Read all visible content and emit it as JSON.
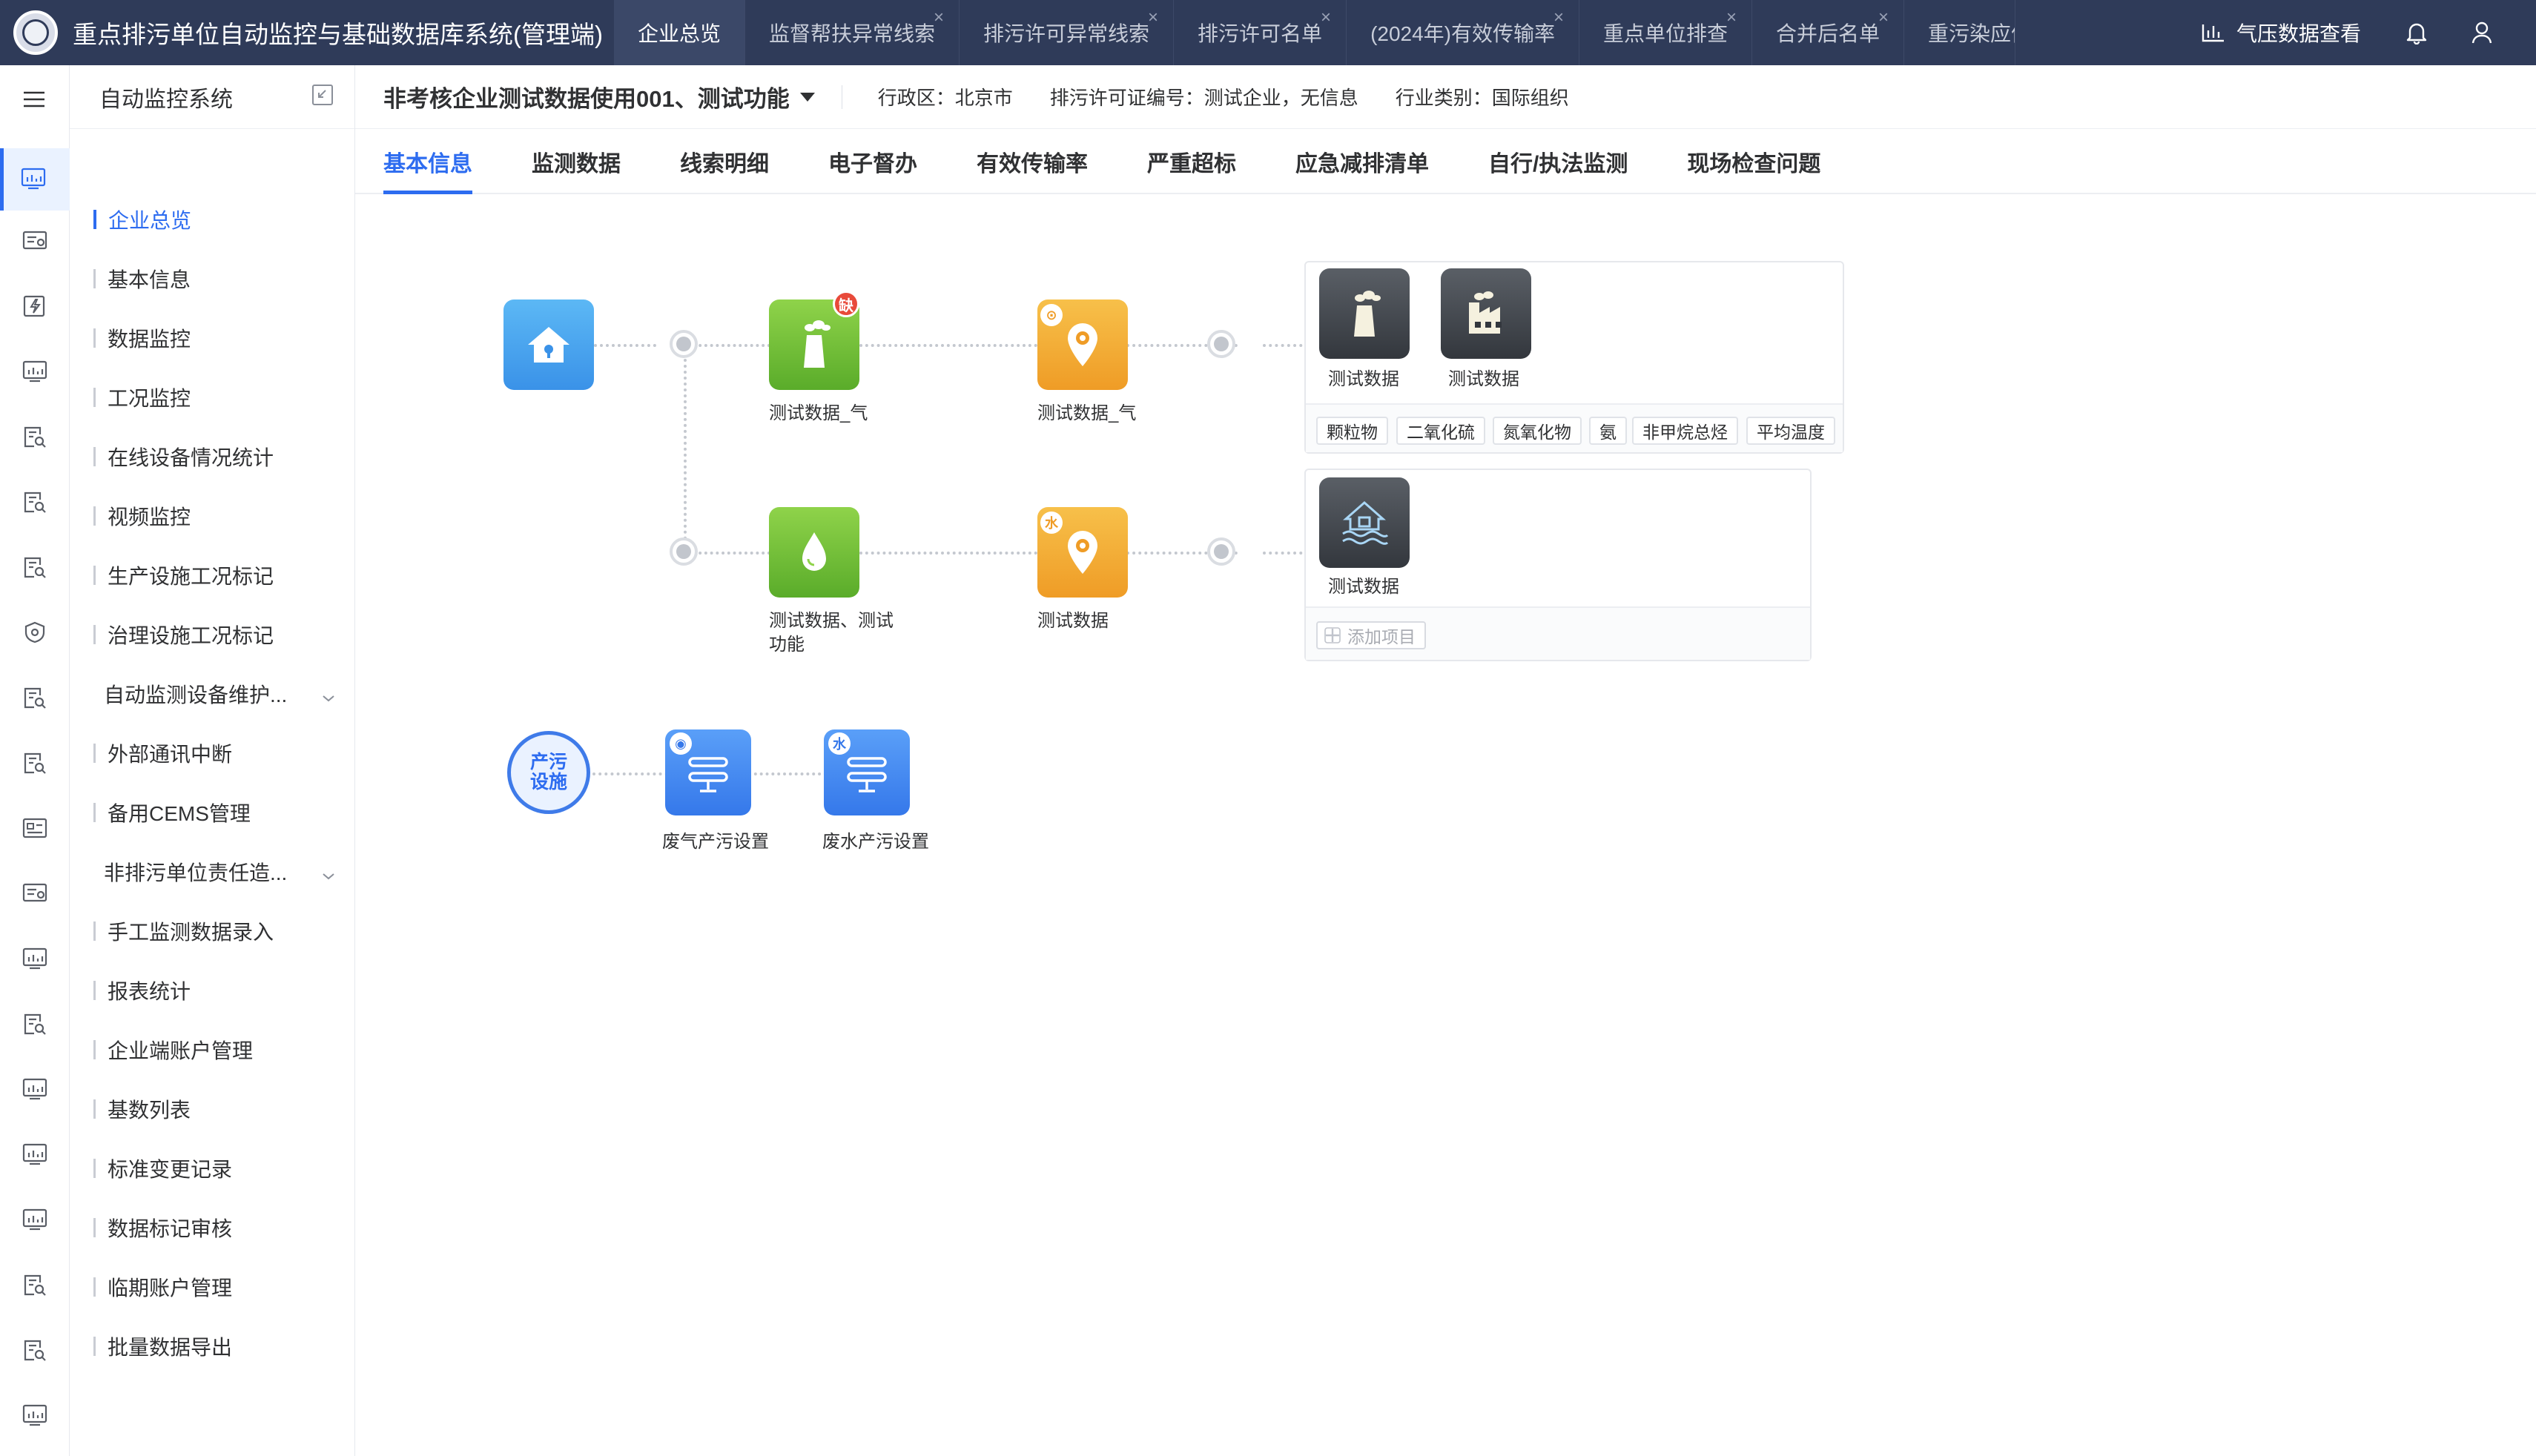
{
  "app": {
    "title": "重点排污单位自动监控与基础数据库系统(管理端)"
  },
  "top_tabs": [
    {
      "label": "企业总览",
      "active": true,
      "closable": false
    },
    {
      "label": "监督帮扶异常线索",
      "active": false,
      "closable": true
    },
    {
      "label": "排污许可异常线索",
      "active": false,
      "closable": true
    },
    {
      "label": "排污许可名单",
      "active": false,
      "closable": true
    },
    {
      "label": "(2024年)有效传输率",
      "active": false,
      "closable": true
    },
    {
      "label": "重点单位排查",
      "active": false,
      "closable": true
    },
    {
      "label": "合并后名单",
      "active": false,
      "closable": true
    },
    {
      "label": "重污染应停",
      "active": false,
      "closable": false
    }
  ],
  "top_right": {
    "pressure_label": "气压数据查看"
  },
  "sidebar": {
    "title": "自动监控系统",
    "items": [
      {
        "label": "企业总览",
        "active": true,
        "group": false
      },
      {
        "label": "基本信息",
        "active": false,
        "group": false
      },
      {
        "label": "数据监控",
        "active": false,
        "group": false
      },
      {
        "label": "工况监控",
        "active": false,
        "group": false
      },
      {
        "label": "在线设备情况统计",
        "active": false,
        "group": false
      },
      {
        "label": "视频监控",
        "active": false,
        "group": false
      },
      {
        "label": "生产设施工况标记",
        "active": false,
        "group": false
      },
      {
        "label": "治理设施工况标记",
        "active": false,
        "group": false
      },
      {
        "label": "自动监测设备维护...",
        "active": false,
        "group": true
      },
      {
        "label": "外部通讯中断",
        "active": false,
        "group": false
      },
      {
        "label": "备用CEMS管理",
        "active": false,
        "group": false
      },
      {
        "label": "非排污单位责任造...",
        "active": false,
        "group": true
      },
      {
        "label": "手工监测数据录入",
        "active": false,
        "group": false
      },
      {
        "label": "报表统计",
        "active": false,
        "group": false
      },
      {
        "label": "企业端账户管理",
        "active": false,
        "group": false
      },
      {
        "label": "基数列表",
        "active": false,
        "group": false
      },
      {
        "label": "标准变更记录",
        "active": false,
        "group": false
      },
      {
        "label": "数据标记审核",
        "active": false,
        "group": false
      },
      {
        "label": "临期账户管理",
        "active": false,
        "group": false
      },
      {
        "label": "批量数据导出",
        "active": false,
        "group": false
      }
    ]
  },
  "enterprise": {
    "name": "非考核企业测试数据使用001、测试功能",
    "region": "行政区：北京市",
    "permit": "排污许可证编号：测试企业，无信息",
    "industry": "行业类别：国际组织"
  },
  "sub_tabs": [
    {
      "label": "基本信息",
      "active": true
    },
    {
      "label": "监测数据",
      "active": false
    },
    {
      "label": "线索明细",
      "active": false
    },
    {
      "label": "电子督办",
      "active": false
    },
    {
      "label": "有效传输率",
      "active": false
    },
    {
      "label": "严重超标",
      "active": false
    },
    {
      "label": "应急减排清单",
      "active": false
    },
    {
      "label": "自行/执法监测",
      "active": false
    },
    {
      "label": "现场检查问题",
      "active": false
    }
  ],
  "diagram": {
    "gas_outlet": {
      "label": "测试数据_气",
      "badge": "缺"
    },
    "gas_point": {
      "label": "测试数据_气"
    },
    "water_outlet": {
      "label_line1": "测试数据、测试",
      "label_line2": "功能"
    },
    "water_point": {
      "label": "测试数据"
    },
    "gas_panel": {
      "items": [
        "测试数据",
        "测试数据"
      ],
      "pollutants": [
        "颗粒物",
        "二氧化硫",
        "氮氧化物",
        "氨",
        "非甲烷总烃",
        "平均温度"
      ]
    },
    "water_panel": {
      "items": [
        "测试数据"
      ],
      "add_label": "添加项目"
    },
    "production": {
      "circle_label": "产污设施",
      "gas_setting": "废气产污设置",
      "water_setting": "废水产污设置",
      "water_badge": "水"
    }
  },
  "colors": {
    "accent": "#2d6cf0",
    "topbar": "#2f3b59",
    "badge": "#e84a3a"
  }
}
